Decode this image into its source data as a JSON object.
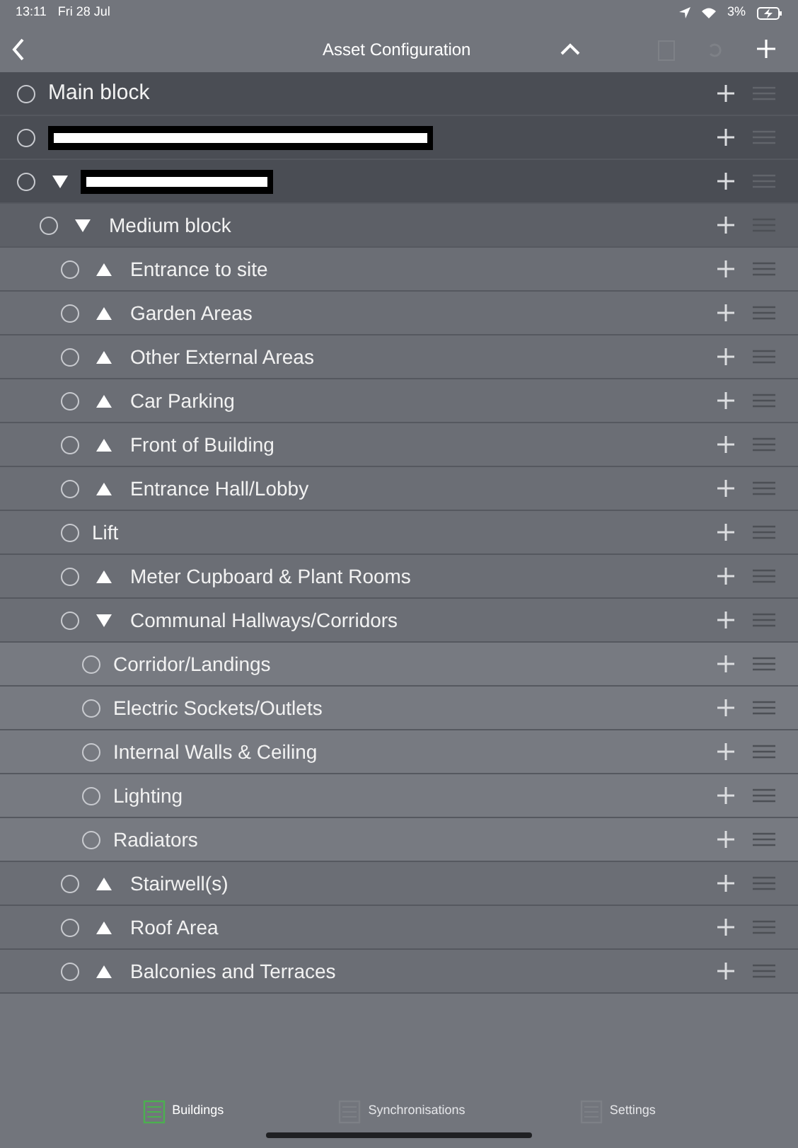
{
  "status_bar": {
    "time": "13:11",
    "date": "Fri 28 Jul",
    "battery": "3%"
  },
  "nav": {
    "title": "Asset Configuration"
  },
  "tree": [
    {
      "label": "Main block"
    },
    {
      "kind": "redacted"
    },
    {
      "kind": "redacted",
      "expanded": true,
      "children": [
        {
          "label": "Medium block",
          "expanded": true,
          "children": [
            {
              "label": "Entrance to site",
              "expanded": false
            },
            {
              "label": "Garden Areas",
              "expanded": false
            },
            {
              "label": "Other External Areas",
              "expanded": false
            },
            {
              "label": "Car Parking",
              "expanded": false
            },
            {
              "label": "Front of Building",
              "expanded": false
            },
            {
              "label": "Entrance Hall/Lobby",
              "expanded": false
            },
            {
              "label": "Lift"
            },
            {
              "label": "Meter Cupboard & Plant Rooms",
              "expanded": false
            },
            {
              "label": "Communal Hallways/Corridors",
              "expanded": true,
              "children": [
                {
                  "label": "Corridor/Landings"
                },
                {
                  "label": "Electric Sockets/Outlets"
                },
                {
                  "label": "Internal Walls & Ceiling"
                },
                {
                  "label": "Lighting"
                },
                {
                  "label": "Radiators"
                }
              ]
            },
            {
              "label": "Stairwell(s)",
              "expanded": false
            },
            {
              "label": "Roof Area",
              "expanded": false
            },
            {
              "label": "Balconies and Terraces",
              "expanded": false
            }
          ]
        }
      ]
    }
  ],
  "tabs": [
    {
      "label": "Buildings",
      "selected": true
    },
    {
      "label": "Synchronisations",
      "selected": false
    },
    {
      "label": "Settings",
      "selected": false
    }
  ]
}
